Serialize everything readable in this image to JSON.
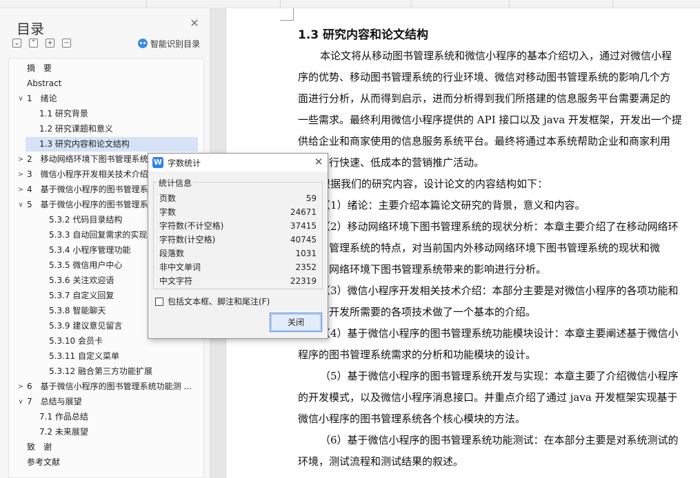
{
  "toc": {
    "title": "目录",
    "smart_label": "智能识别目录",
    "tools": [
      {
        "name": "collapse-all-button",
        "glyph": "⌄"
      },
      {
        "name": "expand-all-button",
        "glyph": "⌃"
      },
      {
        "name": "add-heading-button",
        "glyph": "+"
      },
      {
        "name": "remove-heading-button",
        "glyph": "−"
      }
    ],
    "items": [
      {
        "label": "摘　要",
        "level": 0,
        "chev": ""
      },
      {
        "label": "Abstract",
        "level": 0,
        "chev": ""
      },
      {
        "label": "1　绪论",
        "level": 1,
        "chev": "v"
      },
      {
        "label": "1.1 研究背景",
        "level": 2,
        "chev": ""
      },
      {
        "label": "1.2 研究课题和意义",
        "level": 2,
        "chev": ""
      },
      {
        "label": "1.3 研究内容和论文结构",
        "level": 2,
        "chev": "",
        "active": true
      },
      {
        "label": "2　移动网络环境下图书管理系统",
        "level": 1,
        "chev": ">"
      },
      {
        "label": "3　微信小程序开发相关技术介绍",
        "level": 1,
        "chev": ">"
      },
      {
        "label": "4　基于微信小程序的图书管理系",
        "level": 1,
        "chev": ">"
      },
      {
        "label": "5　基于微信小程序的图书管理系",
        "level": 1,
        "chev": "v"
      },
      {
        "label": "5.3.2 代码目录结构",
        "level": 3,
        "chev": ""
      },
      {
        "label": "5.3.3 自动回复需求的实现",
        "level": 3,
        "chev": ""
      },
      {
        "label": "5.3.4 小程序管理功能",
        "level": 3,
        "chev": ""
      },
      {
        "label": "5.3.5 微信用户中心",
        "level": 3,
        "chev": ""
      },
      {
        "label": "5.3.6 关注欢迎语",
        "level": 3,
        "chev": ""
      },
      {
        "label": "5.3.7 自定义回复",
        "level": 3,
        "chev": ""
      },
      {
        "label": "5.3.8 智能聊天",
        "level": 3,
        "chev": ""
      },
      {
        "label": "5.3.9 建议意见留言",
        "level": 3,
        "chev": ""
      },
      {
        "label": "5.3.10 会员卡",
        "level": 3,
        "chev": ""
      },
      {
        "label": "5.3.11 自定义菜单",
        "level": 3,
        "chev": ""
      },
      {
        "label": "5.3.12 融合第三方功能扩展",
        "level": 3,
        "chev": ""
      },
      {
        "label": "6　基于微信小程序的图书管理系统功能测 ...",
        "level": 1,
        "chev": ">"
      },
      {
        "label": "7　总结与展望",
        "level": 1,
        "chev": "v"
      },
      {
        "label": "7.1 作品总结",
        "level": 2,
        "chev": ""
      },
      {
        "label": "7.2 未来展望",
        "level": 2,
        "chev": ""
      },
      {
        "label": "致　谢",
        "level": 0,
        "chev": ""
      },
      {
        "label": "参考文献",
        "level": 0,
        "chev": ""
      }
    ]
  },
  "document": {
    "heading": "1.3 研究内容和论文结构",
    "lines": [
      "本论文将从移动图书管理系统和微信小程序的基本介绍切入，通过对微信小程",
      "序的优势、移动图书管理系统的行业环境、微信对移动图书管理系统的影响几个方",
      "面进行分析，从而得到启示，进而分析得到我们所搭建的信息服务平台需要满足的",
      "一些需求。最终利用微信小程序提供的 API 接口以及 java 开发框架，开发出一个提",
      "供给企业和商家使用的信息服务系统平台。最终将通过本系统帮助企业和商家利用",
      "平台进行快速、低成本的营销推广活动。",
      "根据我们的研究内容，设计论文的内容结构如下：",
      "（1）绪论：主要介绍本篇论文研究的背景，意义和内容。",
      "（2）移动网络环境下图书管理系统的现状分析：本章主要介绍了在移动网络环",
      "境图书管理系统的特点，对当前国内外移动网络环境下图书管理系统的现状和微",
      "信移动网络环境下图书管理系统带来的影响进行分析。",
      "（3）微信小程序开发相关技术介绍：本部分主要是对微信小程序的各项功能和",
      "小程序开发所需要的各项技术做了一个基本的介绍。",
      "（4）基于微信小程序的图书管理系统功能模块设计：本章主要阐述基于微信小",
      "程序的图书管理系统需求的分析和功能模块的设计。",
      "（5）基于微信小程序的图书管理系统开发与实现：本章主要了介绍微信小程序",
      "的开发模式，以及微信小程序消息接口。并重点介绍了通过 java 开发框架实现基于",
      "微信小程序的图书管理系统各个核心模块的方法。",
      "（6）基于微信小程序的图书管理系统功能测试：在本部分主要是对系统测试的",
      "环境，测试流程和测试结果的叙述。"
    ]
  },
  "dialog": {
    "icon_glyph": "W",
    "title": "字数统计",
    "group_label": "统计信息",
    "stats": [
      {
        "label": "页数",
        "value": "59"
      },
      {
        "label": "字数",
        "value": "24671"
      },
      {
        "label": "字符数(不计空格)",
        "value": "37415"
      },
      {
        "label": "字符数(计空格)",
        "value": "40745"
      },
      {
        "label": "段落数",
        "value": "1031"
      },
      {
        "label": "非中文单词",
        "value": "2352"
      },
      {
        "label": "中文字符",
        "value": "22319"
      }
    ],
    "checkbox_label": "包括文本框、脚注和尾注(F)",
    "checkbox_checked": false,
    "close_label": "关闭"
  }
}
